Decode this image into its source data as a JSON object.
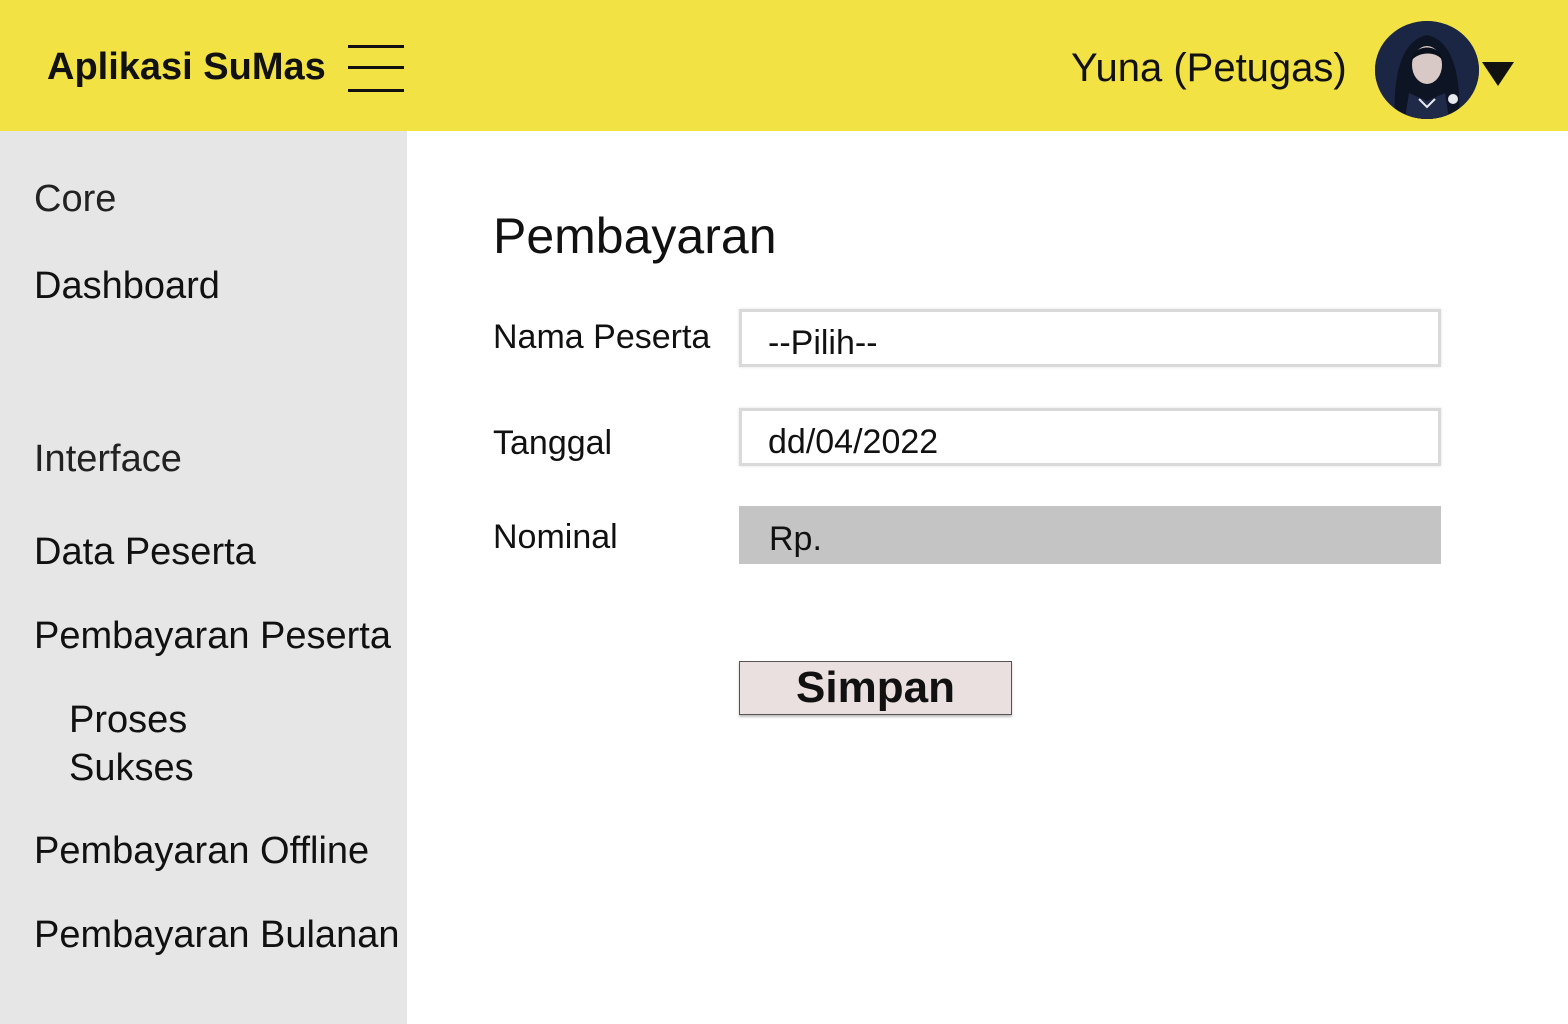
{
  "header": {
    "app_title": "Aplikasi SuMas",
    "user_name": "Yuna (Petugas)",
    "background_color": "#f2e243"
  },
  "sidebar": {
    "section_core": "Core",
    "dashboard": "Dashboard",
    "section_interface": "Interface",
    "items": [
      {
        "label": "Data Peserta"
      },
      {
        "label": "Pembayaran Peserta"
      },
      {
        "label": "Proses"
      },
      {
        "label": "Sukses"
      },
      {
        "label": "Pembayaran Offline"
      },
      {
        "label": "Pembayaran Bulanan"
      }
    ]
  },
  "main": {
    "title": "Pembayaran",
    "form": {
      "nama_label": "Nama Peserta",
      "nama_value": "--Pilih--",
      "tanggal_label": "Tanggal",
      "tanggal_value": "dd/04/2022",
      "nominal_label": "Nominal",
      "nominal_value": "Rp.",
      "save_label": "Simpan"
    }
  }
}
